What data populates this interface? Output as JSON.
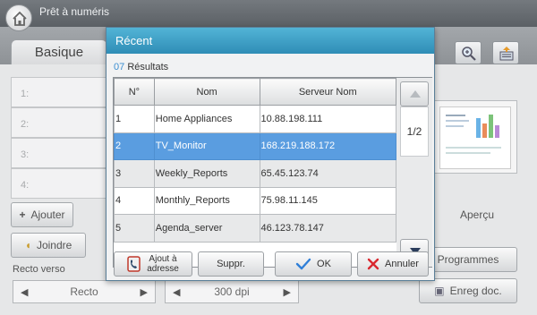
{
  "app": {
    "title": "Prêt à numéris"
  },
  "tabs": {
    "basique": "Basique"
  },
  "destinations": [
    "1:",
    "2:",
    "3:",
    "4:"
  ],
  "background_buttons": {
    "ajouter": "Ajouter",
    "joindre": "Joindre",
    "apercu": "Aperçu",
    "programmes": "Programmes",
    "enreg_doc": "Enreg doc."
  },
  "recto": {
    "label": "Recto verso",
    "value": "Recto"
  },
  "resolution": {
    "value": "300 dpi"
  },
  "modal": {
    "title": "Récent",
    "results_count": "07",
    "results_label": "Résultats",
    "columns": [
      "N°",
      "Nom",
      "Serveur Nom"
    ],
    "rows": [
      {
        "num": "1",
        "name": "Home Appliances",
        "server": "10.88.198.111",
        "selected": false
      },
      {
        "num": "2",
        "name": "TV_Monitor",
        "server": "168.219.188.172",
        "selected": true
      },
      {
        "num": "3",
        "name": "Weekly_Reports",
        "server": "65.45.123.74",
        "selected": false
      },
      {
        "num": "4",
        "name": "Monthly_Reports",
        "server": "75.98.11.145",
        "selected": false
      },
      {
        "num": "5",
        "name": "Agenda_server",
        "server": "46.123.78.147",
        "selected": false
      }
    ],
    "page_indicator": "1/2",
    "buttons": {
      "ajout_line1": "Ajout à",
      "ajout_line2": "adresse",
      "suppr": "Suppr.",
      "ok": "OK",
      "annuler": "Annuler"
    }
  },
  "colors": {
    "header_blue": "#3a9ec7",
    "selected_row": "#5a9de0",
    "ok_check": "#2f7fd8",
    "cancel_x": "#d9282f",
    "results_count": "#3d8fd1"
  }
}
